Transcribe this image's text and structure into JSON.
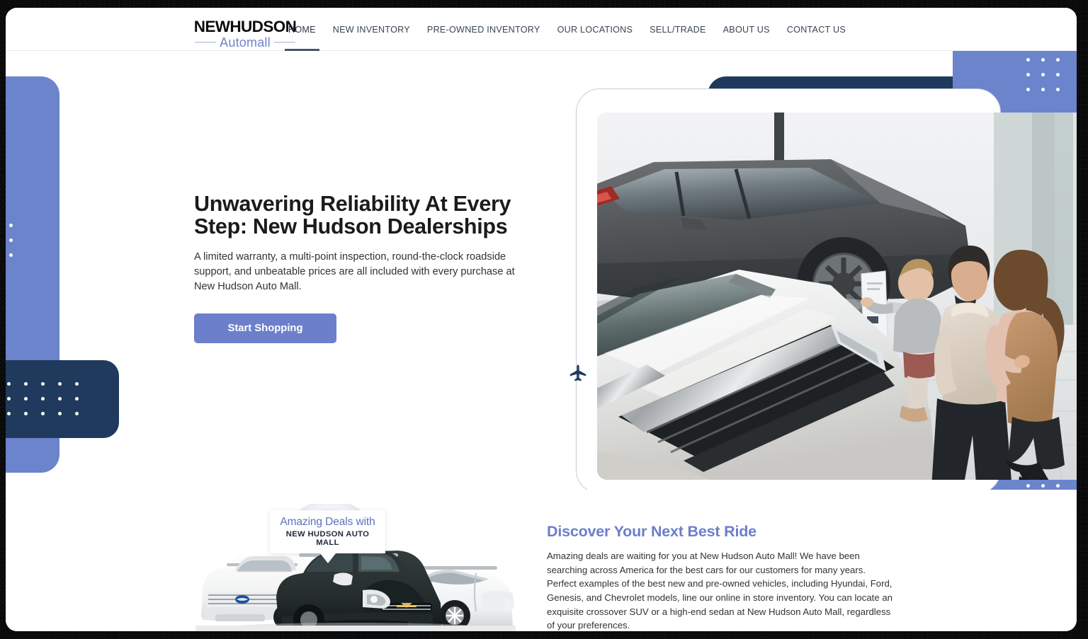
{
  "header": {
    "logo": {
      "primary": "NEWHUDSON",
      "secondary": "Automall"
    },
    "nav_items": [
      {
        "label": "HOME",
        "active": true
      },
      {
        "label": "NEW INVENTORY",
        "active": false
      },
      {
        "label": "PRE-OWNED INVENTORY",
        "active": false
      },
      {
        "label": "OUR LOCATIONS",
        "active": false
      },
      {
        "label": "SELL/TRADE",
        "active": false
      },
      {
        "label": "ABOUT US",
        "active": false
      },
      {
        "label": "CONTACT US",
        "active": false
      }
    ]
  },
  "hero": {
    "heading": "Unwavering Reliability At Every Step: New Hudson Dealerships",
    "subtext": "A limited warranty, a multi-point inspection, round-the-clock roadside support, and unbeatable prices are all included with every purchase at New Hudson Auto Mall.",
    "cta_label": "Start Shopping",
    "photo_alt": "Family with toddler walking through car dealership showroom"
  },
  "discover": {
    "heading": "Discover Your Next Best Ride",
    "body": "Amazing deals are waiting for you at New Hudson Auto Mall! We have been searching across America for the best cars for our customers for many years. Perfect examples of the best new and pre-owned vehicles, including Hyundai, Ford, Genesis, and Chevrolet models, line our online in store inventory. You can locate an exquisite crossover SUV or a high-end sedan at New Hudson Auto Mall, regardless of your preferences.",
    "badge": {
      "title": "Amazing Deals with",
      "subtitle": "NEW HUDSON AUTO MALL"
    }
  },
  "icons": {
    "plane": "airplane-icon"
  },
  "colors": {
    "periwinkle": "#6b84cc",
    "button_blue": "#6b7fcb",
    "navy": "#1f3a5c",
    "nav_text": "#3a4454",
    "heading_dark": "#1b1b1e",
    "body_text": "#2f3338",
    "frame_outline": "#c7ccd6",
    "header_border": "#e9eaee"
  }
}
